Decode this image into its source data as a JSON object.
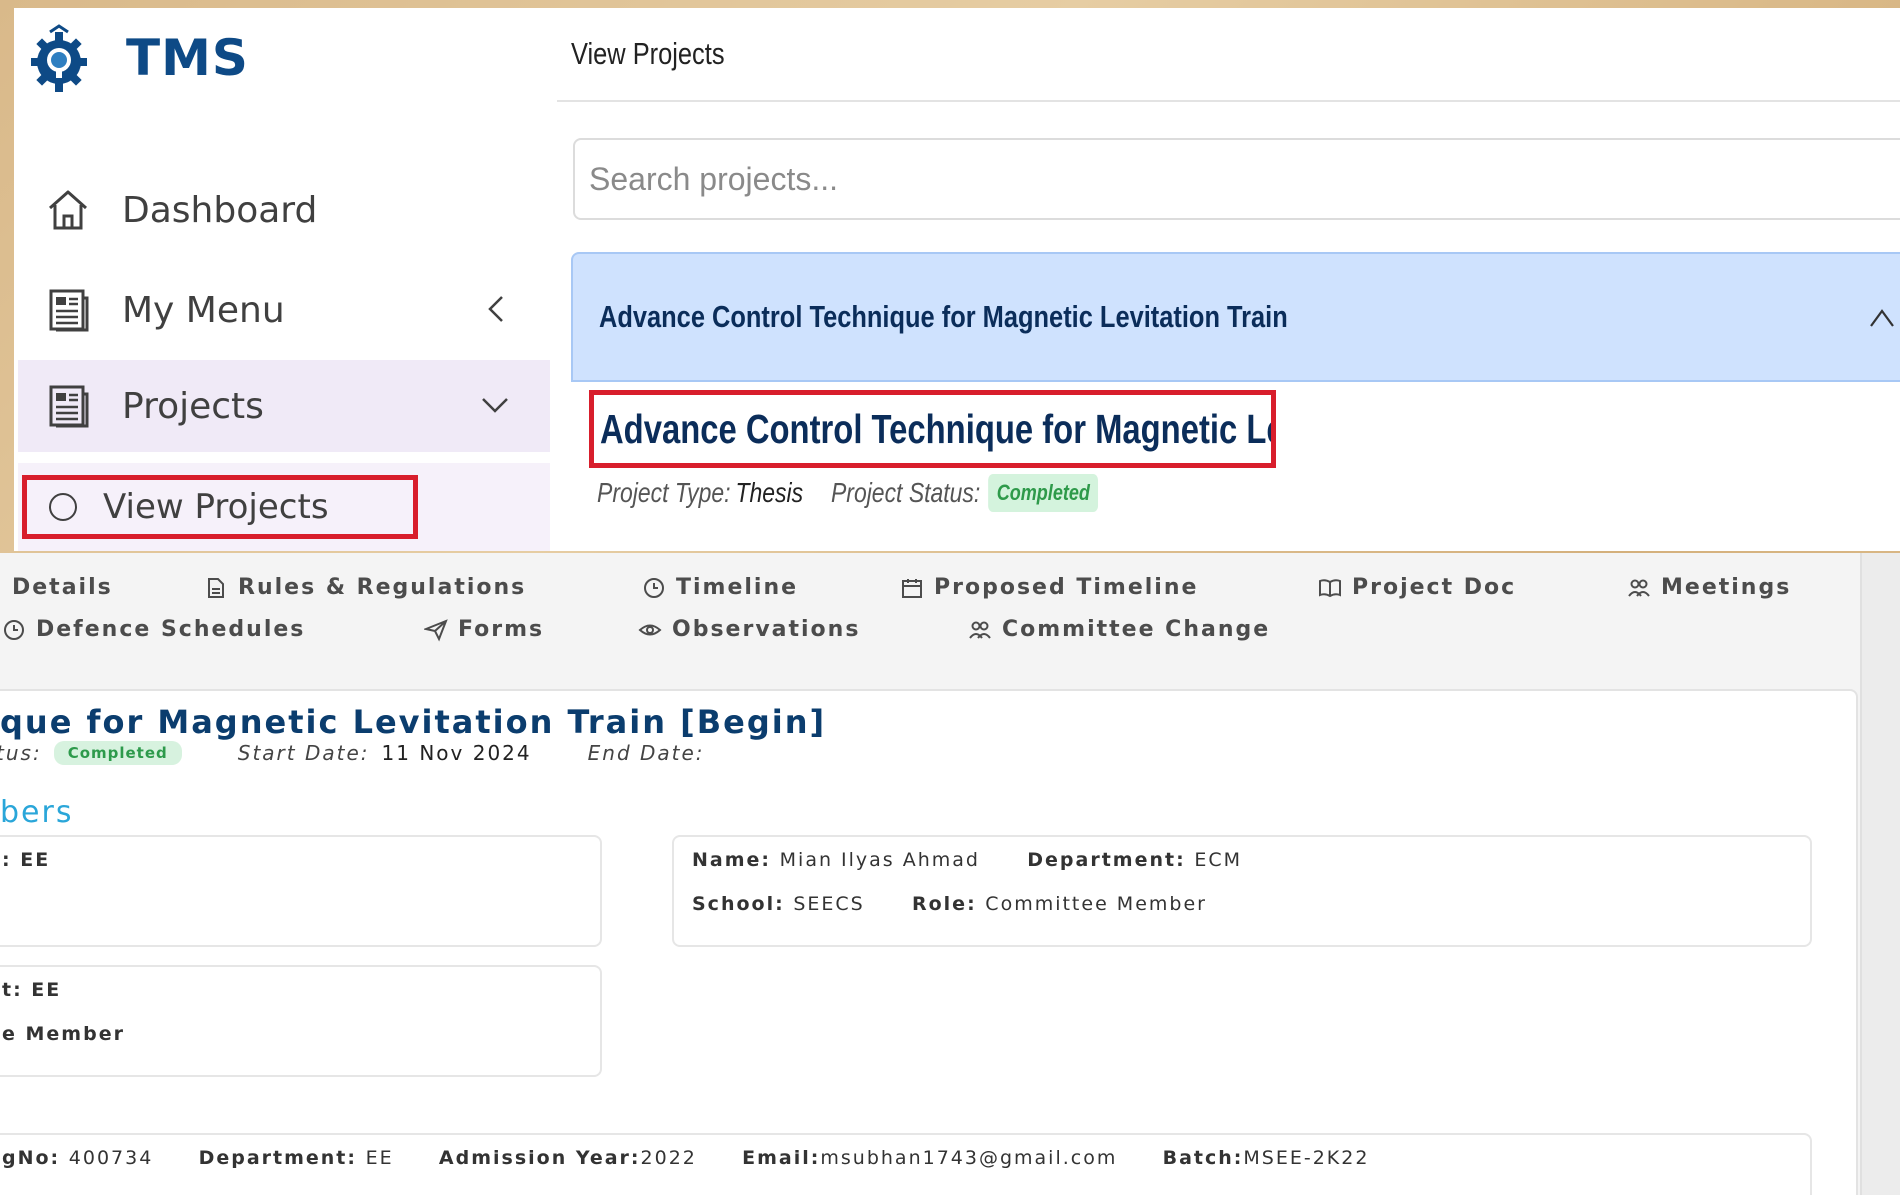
{
  "sidebar": {
    "brand": "TMS",
    "items": [
      {
        "label": "Dashboard",
        "icon": "home-icon"
      },
      {
        "label": "My Menu",
        "icon": "document-icon"
      },
      {
        "label": "Projects",
        "icon": "document-icon"
      }
    ],
    "sub_items": [
      {
        "label": "View Projects",
        "icon": "circle-icon"
      }
    ]
  },
  "header": {
    "title": "View Projects"
  },
  "search": {
    "placeholder": "Search projects..."
  },
  "accordion": {
    "title": "Advance Control Technique for Magnetic Levitation Train"
  },
  "project": {
    "title": "Advance Control Technique for Magnetic Levitation Train",
    "type_label": "Project Type:",
    "type_value": "Thesis",
    "status_label": "Project Status:",
    "status_value": "Completed"
  },
  "tabs": [
    {
      "label": "Details",
      "icon": "none"
    },
    {
      "label": "Rules & Regulations",
      "icon": "file-icon"
    },
    {
      "label": "Timeline",
      "icon": "clock-icon"
    },
    {
      "label": "Proposed Timeline",
      "icon": "calendar-icon"
    },
    {
      "label": "Project Doc",
      "icon": "book-icon"
    },
    {
      "label": "Meetings",
      "icon": "people-icon"
    },
    {
      "label": "Defence Schedules",
      "icon": "clock-icon"
    },
    {
      "label": "Forms",
      "icon": "send-icon"
    },
    {
      "label": "Observations",
      "icon": "eye-icon"
    },
    {
      "label": "Committee Change",
      "icon": "people-icon"
    }
  ],
  "details": {
    "title": "que for Magnetic Levitation Train [Begin]",
    "status_label": "tus:",
    "status_value": "Completed",
    "start_label": "Start Date:",
    "start_value": "11 Nov 2024",
    "end_label": "End Date:",
    "end_value": "",
    "members_heading": "bers",
    "members": [
      {
        "line1": ": EE",
        "line2": ""
      },
      {
        "line1_name_label": "Name:",
        "line1_name": "Mian Ilyas Ahmad",
        "line1_dept_label": "Department:",
        "line1_dept": "ECM",
        "line2_school_label": "School:",
        "line2_school": "SEECS",
        "line2_role_label": "Role:",
        "line2_role": "Committee Member"
      },
      {
        "line1": "t: EE",
        "line2": "e Member"
      }
    ],
    "student": {
      "reg_label": "gNo:",
      "reg_value": "400734",
      "dept_label": "Department:",
      "dept_value": "EE",
      "year_label": "Admission Year:",
      "year_value": "2022",
      "email_label": "Email:",
      "email_value": "msubhan1743@gmail.com",
      "batch_label": "Batch:",
      "batch_value": "MSEE-2K22"
    }
  },
  "colors": {
    "brand": "#0e4a86",
    "highlight_border": "#d81e2c",
    "accordion_bg": "#cfe2fe",
    "badge_bg": "#d4f3dd",
    "badge_text": "#2e9a4a",
    "members_heading": "#2aa6d9"
  }
}
